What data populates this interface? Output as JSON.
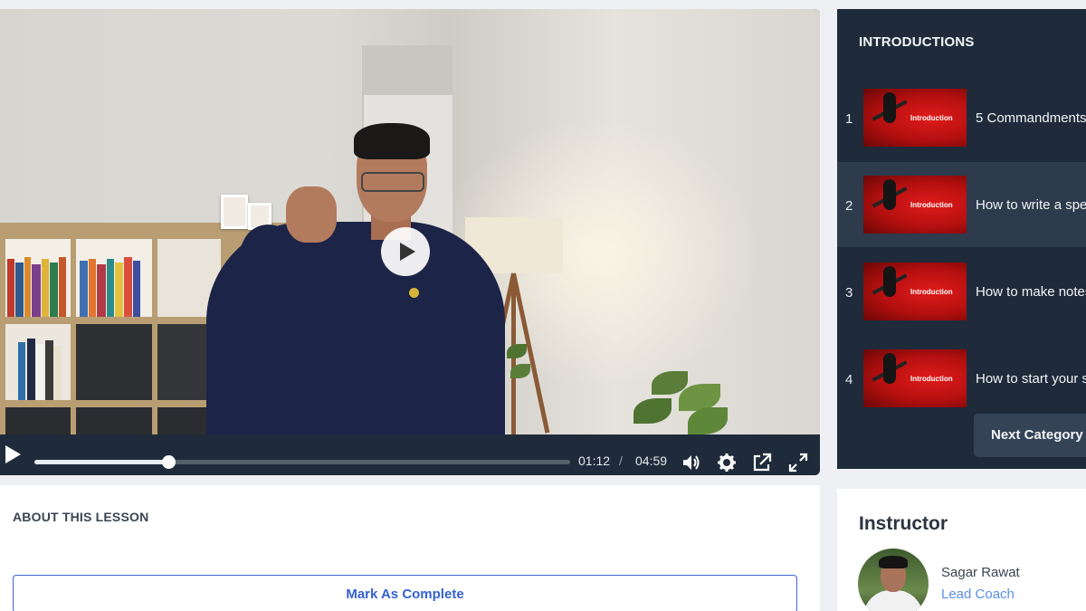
{
  "video": {
    "current_time": "01:12",
    "separator": "/",
    "duration": "04:59",
    "progress_fraction": 0.25,
    "controls": [
      "play-icon",
      "volume-icon",
      "settings-gear-icon",
      "external-link-icon",
      "fullscreen-icon"
    ]
  },
  "playlist": {
    "category_title": "INTRODUCTIONS",
    "thumbnail_text": "Introduction",
    "items": [
      {
        "number": "1",
        "title": "5 Commandments"
      },
      {
        "number": "2",
        "title": "How to write a speech"
      },
      {
        "number": "3",
        "title": "How to make notes"
      },
      {
        "number": "4",
        "title": "How to start your speech"
      }
    ],
    "active_index": 1,
    "next_button": "Next Category"
  },
  "about": {
    "title": "ABOUT THIS LESSON",
    "mark_complete": "Mark As Complete"
  },
  "instructor": {
    "heading": "Instructor",
    "name": "Sagar Rawat",
    "role": "Lead Coach"
  },
  "colors": {
    "panel_dark": "#1f2b3a",
    "active_row": "#2d3b4d",
    "accent_blue": "#3561d4",
    "link_blue": "#5b8fe6"
  }
}
